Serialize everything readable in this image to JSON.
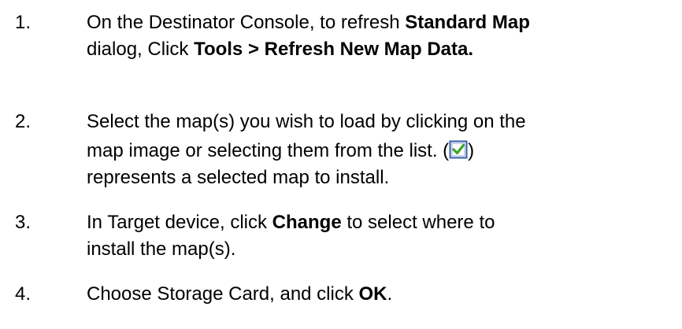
{
  "steps": [
    {
      "number": "1.",
      "line1_a": "On the Destinator Console, to refresh ",
      "line1_bold": "Standard Map",
      "line2_a": "dialog, Click ",
      "line2_bold": "Tools > Refresh New Map Data."
    },
    {
      "number": "2.",
      "line1": "Select the map(s) you wish to load by clicking on the",
      "line2_a": "map image or selecting them from the list.  (",
      "icon": "checked-checkbox-icon",
      "line2_b": ")",
      "line3": "represents a selected map to install."
    },
    {
      "number": "3.",
      "line1_a": "In Target device, click ",
      "line1_bold": "Change",
      "line1_b": " to select where to",
      "line2": "install the map(s)."
    },
    {
      "number": "4.",
      "line1_a": "Choose Storage Card, and click ",
      "line1_bold": "OK",
      "line1_b": "."
    }
  ]
}
